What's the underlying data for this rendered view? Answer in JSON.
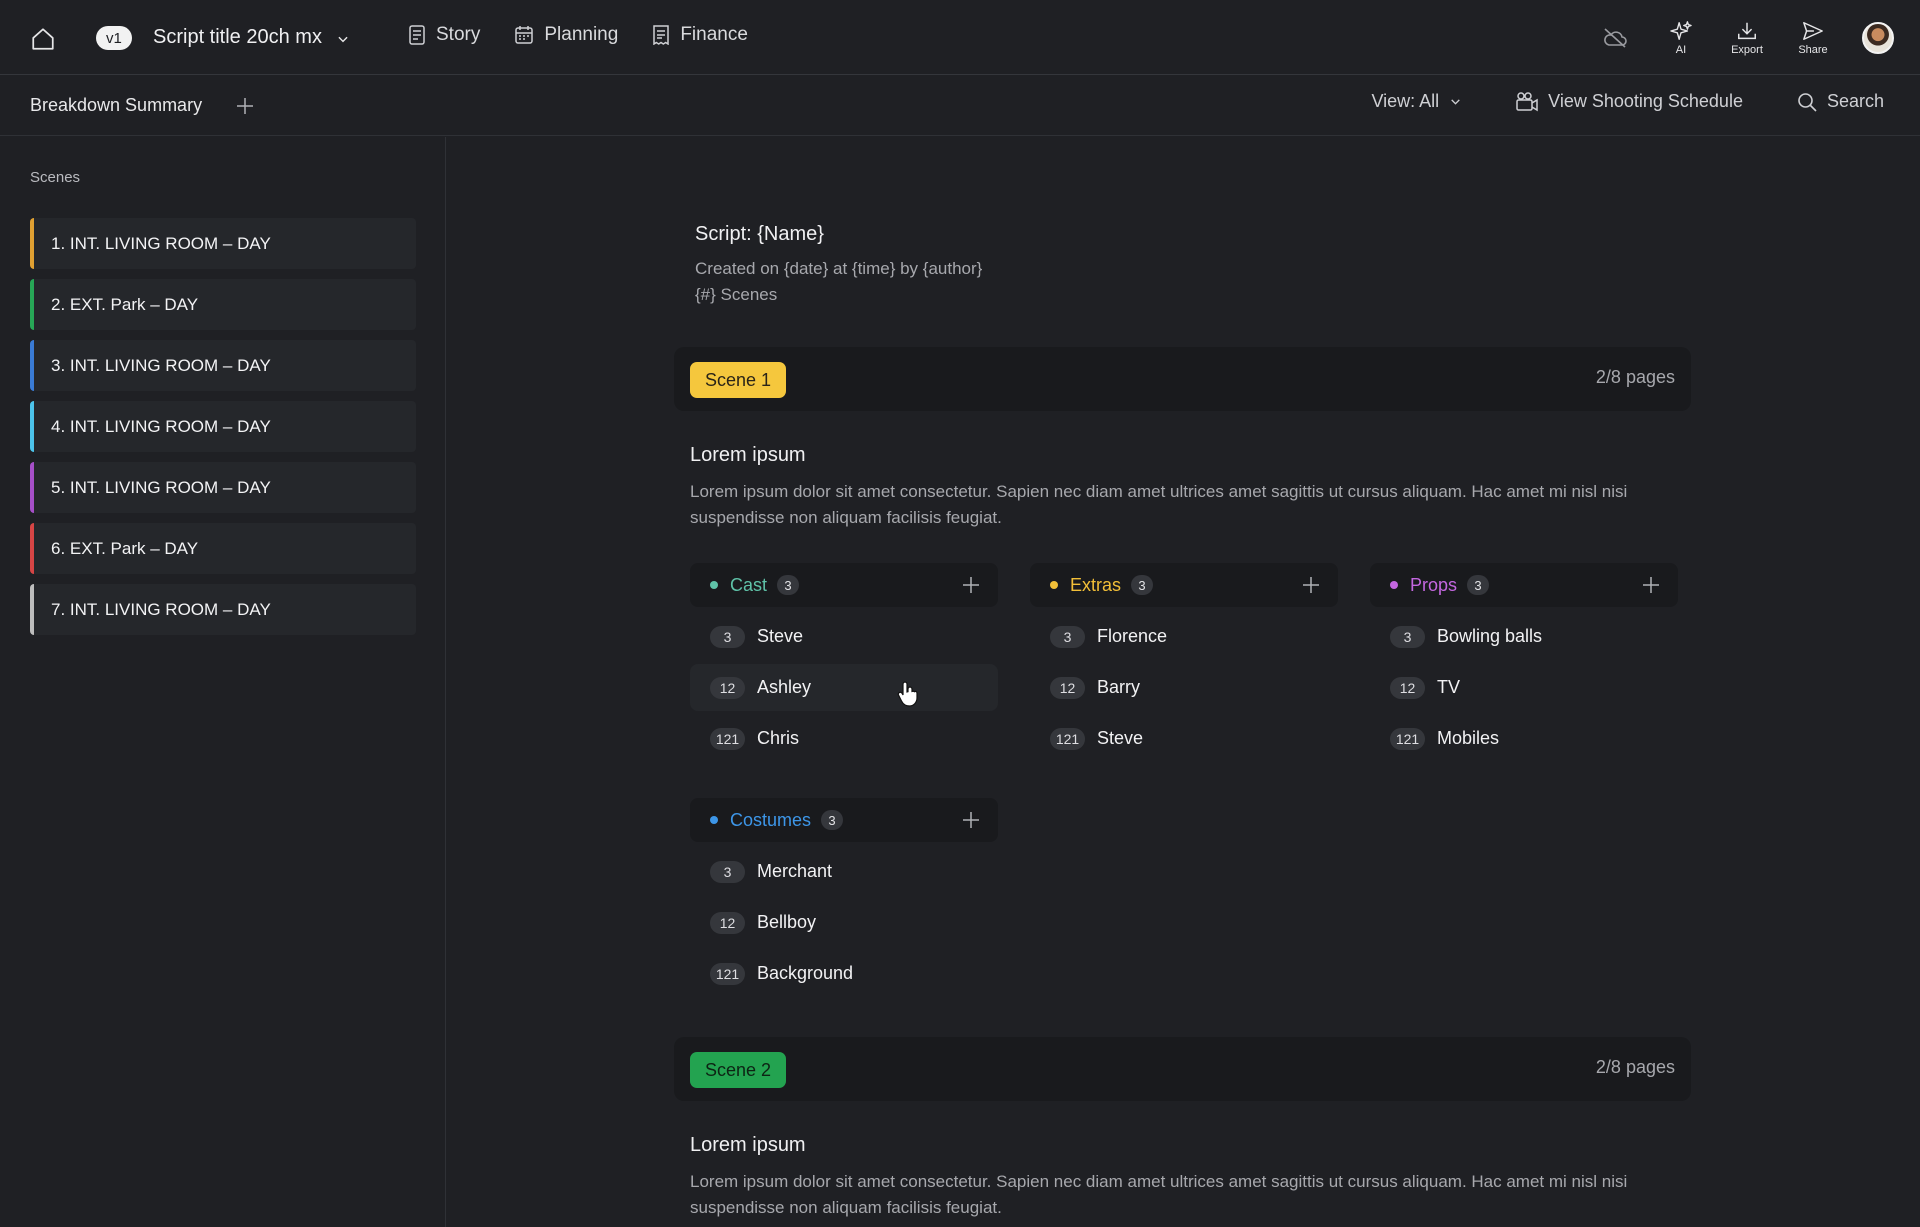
{
  "topbar": {
    "version": "v1",
    "script_title": "Script title 20ch mx",
    "nav": [
      {
        "label": "Story",
        "icon": "document-icon"
      },
      {
        "label": "Planning",
        "icon": "calendar-icon"
      },
      {
        "label": "Finance",
        "icon": "receipt-icon"
      }
    ],
    "actions": {
      "ai": "AI",
      "export": "Export",
      "share": "Share"
    }
  },
  "subbar": {
    "title": "Breakdown Summary",
    "view": "View: All",
    "shooting_schedule": "View Shooting Schedule",
    "search": "Search"
  },
  "sidebar": {
    "heading": "Scenes",
    "scenes": [
      {
        "label": "1. INT. LIVING ROOM – DAY",
        "color": "#e0a032"
      },
      {
        "label": "2. EXT. Park – DAY",
        "color": "#27a656"
      },
      {
        "label": "3. INT. LIVING ROOM – DAY",
        "color": "#3a7bd5"
      },
      {
        "label": "4. INT. LIVING ROOM – DAY",
        "color": "#4cc3ea"
      },
      {
        "label": "5. INT. LIVING ROOM – DAY",
        "color": "#a64fc8"
      },
      {
        "label": "6. EXT. Park – DAY",
        "color": "#d64545"
      },
      {
        "label": "7. INT. LIVING ROOM – DAY",
        "color": "#bdbdbd"
      }
    ]
  },
  "script": {
    "name": "Script: {Name}",
    "created": "Created on {date} at {time} by {author}",
    "scenes_count": "{#} Scenes"
  },
  "scenes": [
    {
      "badge": "Scene 1",
      "badge_bg": "#f5c73d",
      "badge_fg": "#2a2418",
      "pages": "2/8 pages",
      "heading": "Lorem ipsum",
      "description": "Lorem ipsum dolor sit amet consectetur. Sapien nec diam amet ultrices amet sagittis ut cursus aliquam. Hac amet mi nisl nisi suspendisse non aliquam facilisis feugiat.",
      "categories": [
        {
          "name": "Cast",
          "count": "3",
          "color": "#5fc2a8",
          "items": [
            {
              "num": "3",
              "name": "Steve"
            },
            {
              "num": "12",
              "name": "Ashley"
            },
            {
              "num": "121",
              "name": "Chris"
            }
          ]
        },
        {
          "name": "Extras",
          "count": "3",
          "color": "#f2bf38",
          "items": [
            {
              "num": "3",
              "name": "Florence"
            },
            {
              "num": "12",
              "name": "Barry"
            },
            {
              "num": "121",
              "name": "Steve"
            }
          ]
        },
        {
          "name": "Props",
          "count": "3",
          "color": "#c467e0",
          "items": [
            {
              "num": "3",
              "name": "Bowling balls"
            },
            {
              "num": "12",
              "name": "TV"
            },
            {
              "num": "121",
              "name": "Mobiles"
            }
          ]
        },
        {
          "name": "Costumes",
          "count": "3",
          "color": "#3d96e8",
          "items": [
            {
              "num": "3",
              "name": "Merchant"
            },
            {
              "num": "12",
              "name": "Bellboy"
            },
            {
              "num": "121",
              "name": "Background"
            }
          ]
        }
      ]
    },
    {
      "badge": "Scene 2",
      "badge_bg": "#23a350",
      "badge_fg": "#0d2414",
      "pages": "2/8 pages",
      "heading": "Lorem ipsum",
      "description": "Lorem ipsum dolor sit amet consectetur. Sapien nec diam amet ultrices amet sagittis ut cursus aliquam. Hac amet mi nisl nisi suspendisse non aliquam facilisis feugiat."
    }
  ]
}
